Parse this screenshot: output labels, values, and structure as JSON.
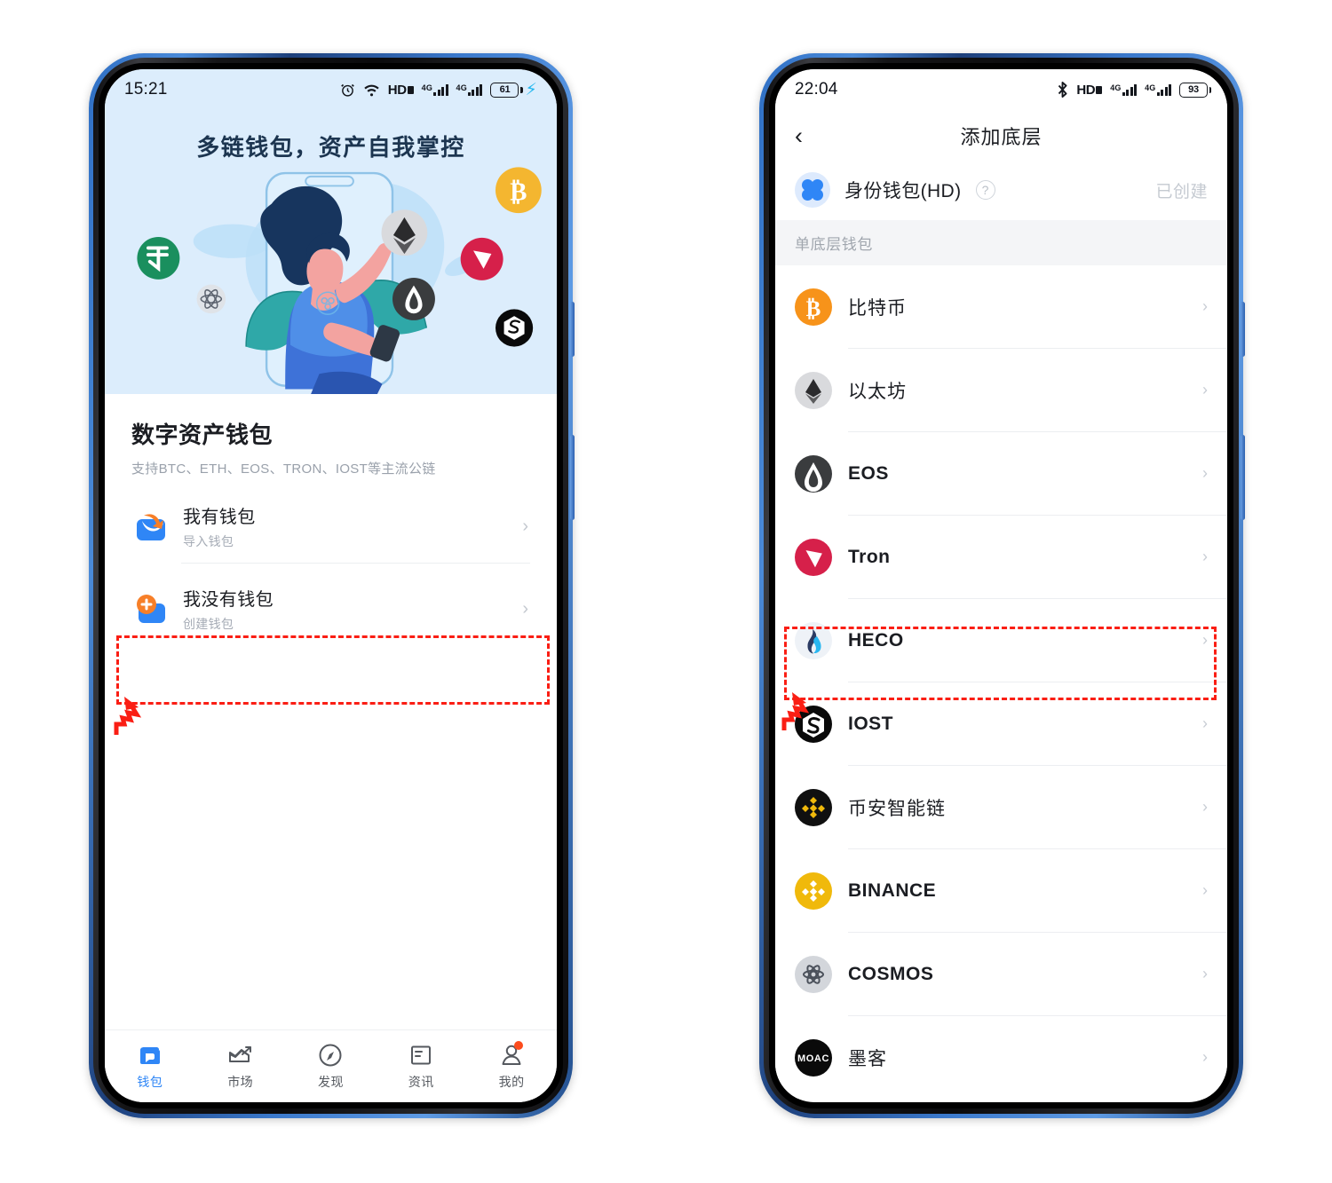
{
  "left_phone": {
    "statusbar": {
      "time": "15:21",
      "hd_label": "HD",
      "battery": "61",
      "icons": [
        "alarm-icon",
        "wifi-icon",
        "hd-icon",
        "signal-4g-icon",
        "signal-4g-icon",
        "battery-icon",
        "charging-bolt-icon"
      ]
    },
    "hero": {
      "title": "多链钱包，资产自我掌控"
    },
    "card": {
      "title": "数字资产钱包",
      "subtitle": "支持BTC、ETH、EOS、TRON、IOST等主流公链",
      "rows": [
        {
          "title": "我有钱包",
          "sub": "导入钱包",
          "icon": "wallet-import-icon",
          "highlighted": false
        },
        {
          "title": "我没有钱包",
          "sub": "创建钱包",
          "icon": "wallet-create-icon",
          "highlighted": true
        }
      ]
    },
    "bottom_nav": {
      "items": [
        {
          "label": "钱包",
          "icon": "wallet-icon",
          "active": true,
          "badge": false
        },
        {
          "label": "市场",
          "icon": "market-chart-icon",
          "active": false,
          "badge": false
        },
        {
          "label": "发现",
          "icon": "compass-icon",
          "active": false,
          "badge": false
        },
        {
          "label": "资讯",
          "icon": "news-icon",
          "active": false,
          "badge": false
        },
        {
          "label": "我的",
          "icon": "profile-icon",
          "active": false,
          "badge": true
        }
      ]
    }
  },
  "right_phone": {
    "statusbar": {
      "time": "22:04",
      "hd_label": "HD",
      "battery": "93",
      "icons": [
        "bluetooth-icon",
        "hd-icon",
        "signal-4g-icon",
        "signal-4g-icon",
        "battery-icon"
      ]
    },
    "navbar": {
      "title": "添加底层",
      "back_icon": "back-chevron-icon"
    },
    "hd_wallet": {
      "label": "身份钱包(HD)",
      "help_icon": "question-mark-icon",
      "status": "已创建",
      "icon": "hd-wallet-clover-icon"
    },
    "section_header": "单底层钱包",
    "chains": [
      {
        "name": "比特币",
        "icon": "bitcoin-icon",
        "color": "#f7931a",
        "cn": true,
        "highlighted": false
      },
      {
        "name": "以太坊",
        "icon": "ethereum-icon",
        "color": "#d8d8d8",
        "cn": true,
        "highlighted": false
      },
      {
        "name": "EOS",
        "icon": "eos-icon",
        "color": "#3a3c3e",
        "cn": false,
        "highlighted": false
      },
      {
        "name": "Tron",
        "icon": "tron-icon",
        "color": "#d6204a",
        "cn": false,
        "highlighted": false
      },
      {
        "name": "HECO",
        "icon": "heco-flame-icon",
        "color": "#f0f3f7",
        "cn": false,
        "highlighted": true
      },
      {
        "name": "IOST",
        "icon": "iost-icon",
        "color": "#0a0a0a",
        "cn": false,
        "highlighted": false
      },
      {
        "name": "币安智能链",
        "icon": "bsc-icon",
        "color": "#101010",
        "cn": true,
        "highlighted": false
      },
      {
        "name": "BINANCE",
        "icon": "binance-icon",
        "color": "#f0b90b",
        "cn": false,
        "highlighted": false
      },
      {
        "name": "COSMOS",
        "icon": "cosmos-icon",
        "color": "#d3d6db",
        "cn": false,
        "highlighted": false
      },
      {
        "name": "墨客",
        "icon": "moac-icon",
        "color": "#0a0a0a",
        "cn": true,
        "highlighted": false
      }
    ]
  },
  "annotation": {
    "color": "#fa1e14",
    "style": "dashed-box-with-arrow"
  }
}
